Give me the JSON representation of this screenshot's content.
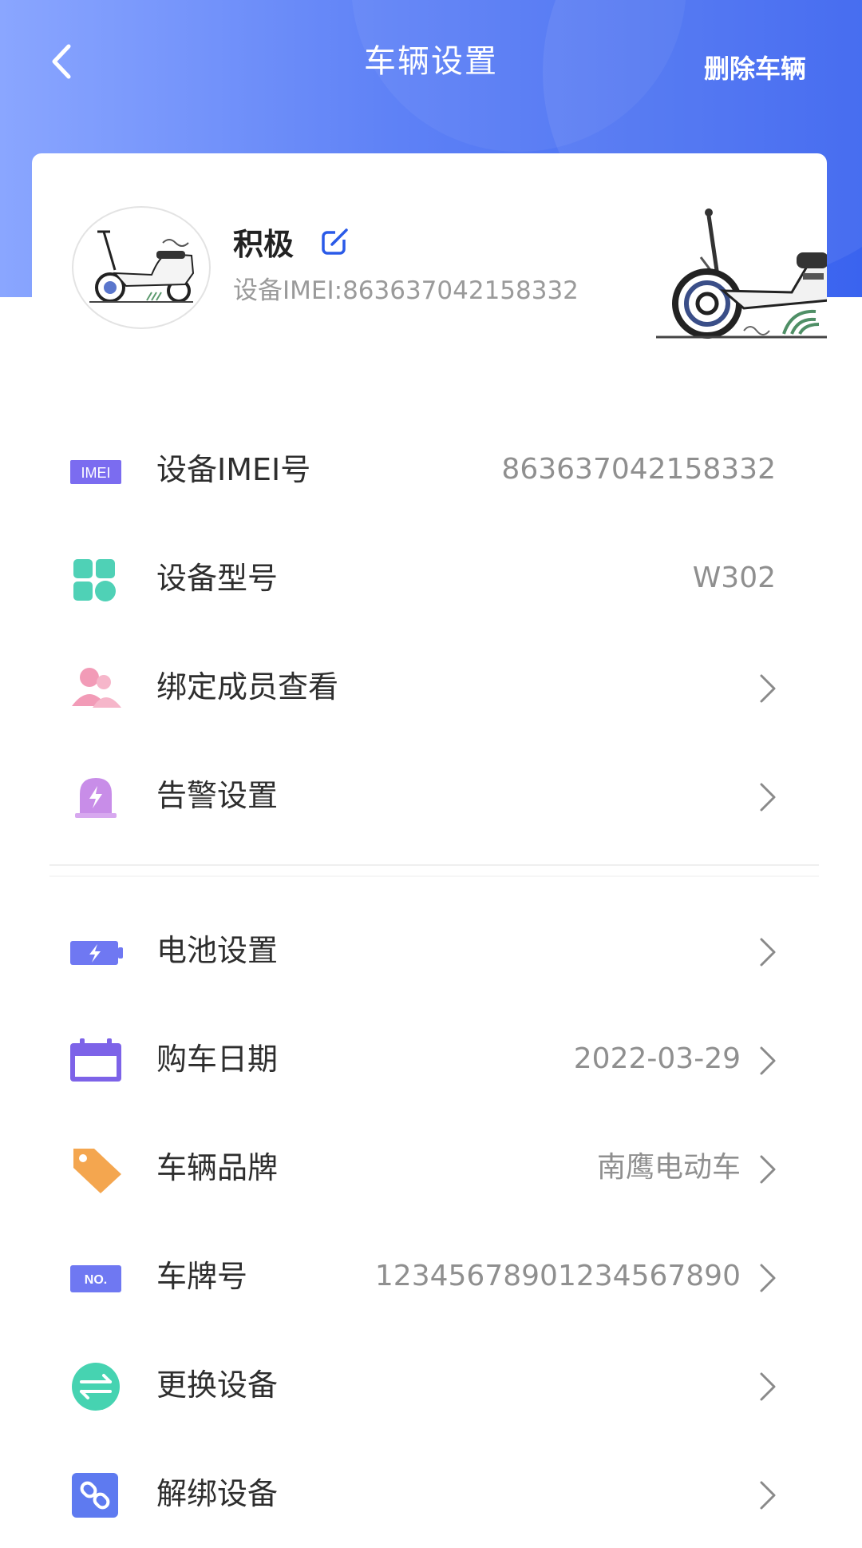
{
  "header": {
    "title": "车辆设置",
    "delete_label": "删除车辆",
    "back_icon": "chevron-left-icon",
    "gradient_colors": [
      "#8aa6ff",
      "#3a63ef"
    ]
  },
  "vehicle": {
    "name": "积极",
    "imei_line": "设备IMEI:863637042158332",
    "edit_icon": "edit-icon"
  },
  "groups": [
    {
      "rows": [
        {
          "label": "设备IMEI号",
          "value": "863637042158332",
          "icon": "imei-icon",
          "chevron": false
        },
        {
          "label": "设备型号",
          "value": "W302",
          "icon": "grid-icon",
          "chevron": false
        },
        {
          "label": "绑定成员查看",
          "value": "",
          "icon": "members-icon",
          "chevron": true
        },
        {
          "label": "告警设置",
          "value": "",
          "icon": "alarm-icon",
          "chevron": true
        }
      ]
    },
    {
      "rows": [
        {
          "label": "电池设置",
          "value": "",
          "icon": "battery-icon",
          "chevron": true
        },
        {
          "label": "购车日期",
          "value": "2022-03-29",
          "icon": "calendar-icon",
          "chevron": true
        },
        {
          "label": "车辆品牌",
          "value": "南鹰电动车",
          "icon": "tag-icon",
          "chevron": true
        },
        {
          "label": "车牌号",
          "value": "12345678901234567890",
          "icon": "plate-icon",
          "chevron": true
        },
        {
          "label": "更换设备",
          "value": "",
          "icon": "swap-icon",
          "chevron": true
        },
        {
          "label": "解绑设备",
          "value": "",
          "icon": "unlink-icon",
          "chevron": true
        }
      ]
    }
  ],
  "colors": {
    "accent": "#3a63ef",
    "imei": "#7b6cf0",
    "grid": "#4fd1b6",
    "members": "#f29bb7",
    "alarm": "#c88de8",
    "battery": "#6f78f2",
    "calendar": "#7d63e8",
    "tag": "#f4a64f",
    "plate": "#6f78f2",
    "swap": "#46d3b1",
    "unlink": "#5e7af0"
  }
}
